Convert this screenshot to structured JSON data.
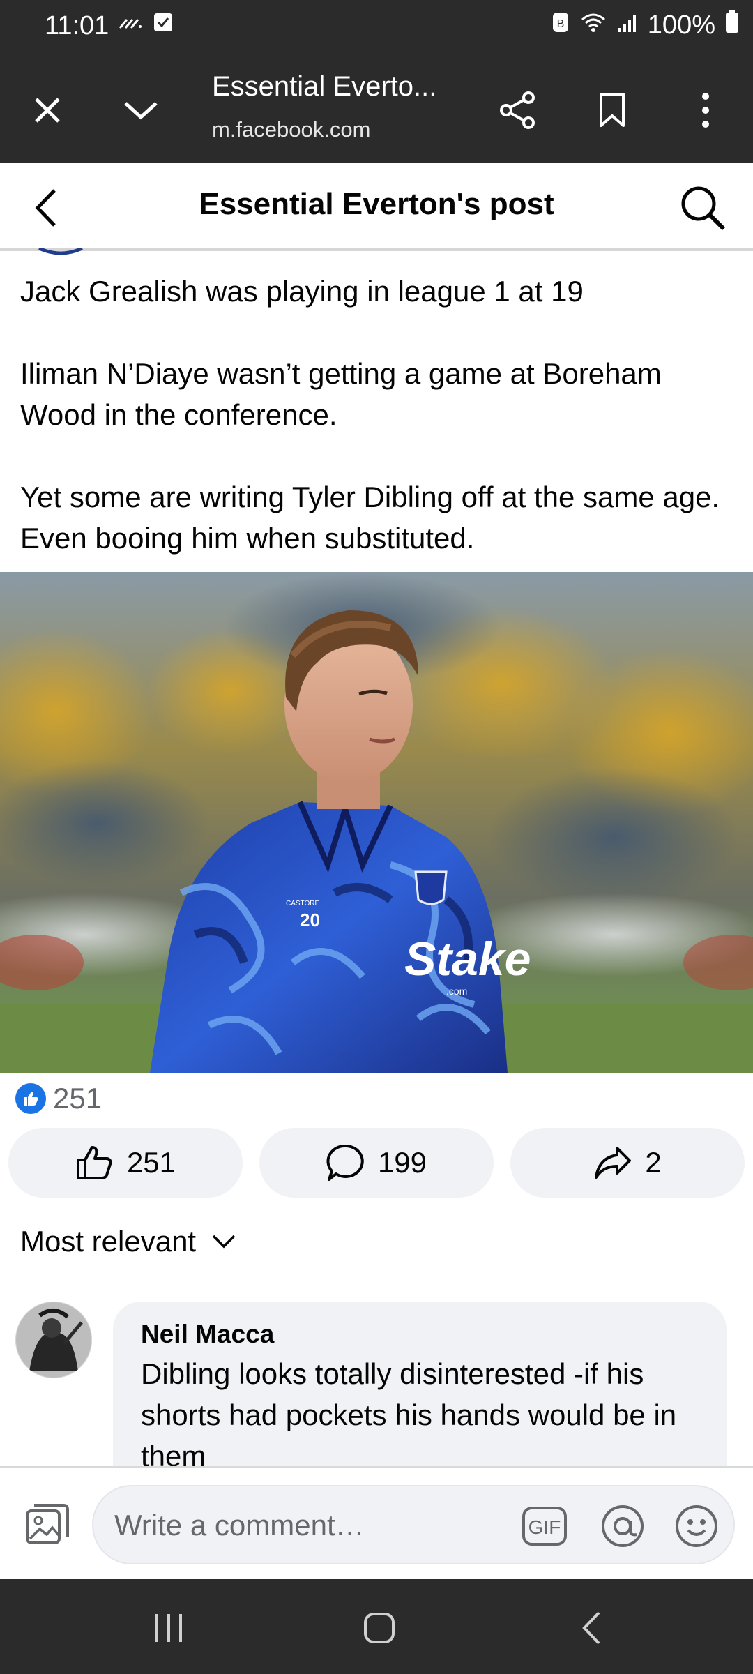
{
  "status_bar": {
    "time": "11:01",
    "battery": "100%"
  },
  "browser": {
    "page_title": "Essential Everto...",
    "url": "m.facebook.com"
  },
  "header": {
    "title": "Essential Everton's post"
  },
  "post": {
    "lines": [
      "Jack Grealish was playing in league 1 at 19",
      "Iliman N’Diaye wasn’t getting a game at Boreham Wood in the conference.",
      "Yet some are writing Tyler Dibling off at the same age. Even booing him when substituted."
    ],
    "image": {
      "jersey_number": "20",
      "sponsor": "Stake",
      "sponsor_sub": ".com",
      "brand_text": "CASTORE"
    }
  },
  "reactions": {
    "count": "251"
  },
  "actions": {
    "like_count": "251",
    "comment_count": "199",
    "share_count": "2"
  },
  "comments": {
    "sort_label": "Most relevant",
    "items": [
      {
        "author": "Neil Macca",
        "text": "Dibling looks totally disinterested -if his shorts had pockets his hands would be in them"
      }
    ]
  },
  "composer": {
    "placeholder": "Write a comment…",
    "gif_label": "GIF"
  },
  "colors": {
    "chrome_bg": "#2b2b2b",
    "fb_blue": "#1b74e4",
    "surface_grey": "#f0f2f5",
    "secondary_text": "#65676b"
  }
}
